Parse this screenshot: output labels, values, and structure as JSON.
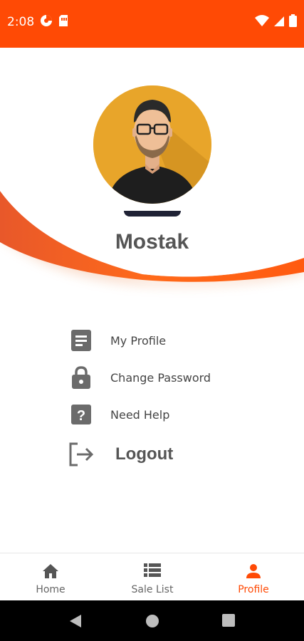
{
  "status_bar": {
    "time": "2:08",
    "left_icons": [
      "pie-chart-icon",
      "sim-card-icon"
    ],
    "right_icons": [
      "wifi-icon",
      "signal-icon",
      "battery-icon"
    ],
    "color": "#ff4a05"
  },
  "profile": {
    "name": "Mostak",
    "avatar": "avatar-icon"
  },
  "menu": {
    "items": [
      {
        "label": "My Profile",
        "icon": "document-icon"
      },
      {
        "label": "Change Password",
        "icon": "lock-icon"
      },
      {
        "label": "Need Help",
        "icon": "help-icon"
      }
    ],
    "logout_label": "Logout"
  },
  "bottom_nav": {
    "items": [
      {
        "label": "Home",
        "icon": "home-icon",
        "active": false
      },
      {
        "label": "Sale List",
        "icon": "list-icon",
        "active": false
      },
      {
        "label": "Profile",
        "icon": "person-icon",
        "active": true
      }
    ],
    "active_color": "#ff4a05"
  },
  "system_nav": {
    "buttons": [
      "back-icon",
      "home-circle-icon",
      "recents-icon"
    ]
  }
}
